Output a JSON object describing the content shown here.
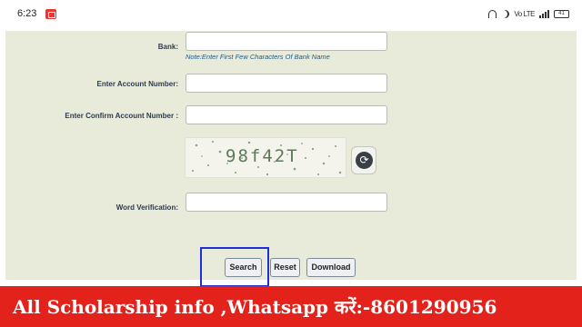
{
  "status_bar": {
    "time": "6:23",
    "signal_label": "Vo LTE",
    "battery_level": "41"
  },
  "form": {
    "bank_label": "Bank:",
    "bank_value": "",
    "bank_note": "Note:Enter First Few Characters Of Bank Name",
    "account_label": "Enter Account Number:",
    "account_value": "",
    "confirm_account_label": "Enter Confirm Account Number :",
    "confirm_account_value": "",
    "captcha_text": "98f42T",
    "word_verification_label": "Word Verification:",
    "word_verification_value": ""
  },
  "buttons": {
    "search": "Search",
    "reset": "Reset",
    "download": "Download"
  },
  "banner": {
    "text": "All Scholarship info ,Whatsapp करें:-8601290956"
  },
  "colors": {
    "panel_bg": "#e8ebd9",
    "banner_bg": "#e4221c",
    "highlight": "#1f2fd1",
    "note": "#1f5a8a"
  }
}
